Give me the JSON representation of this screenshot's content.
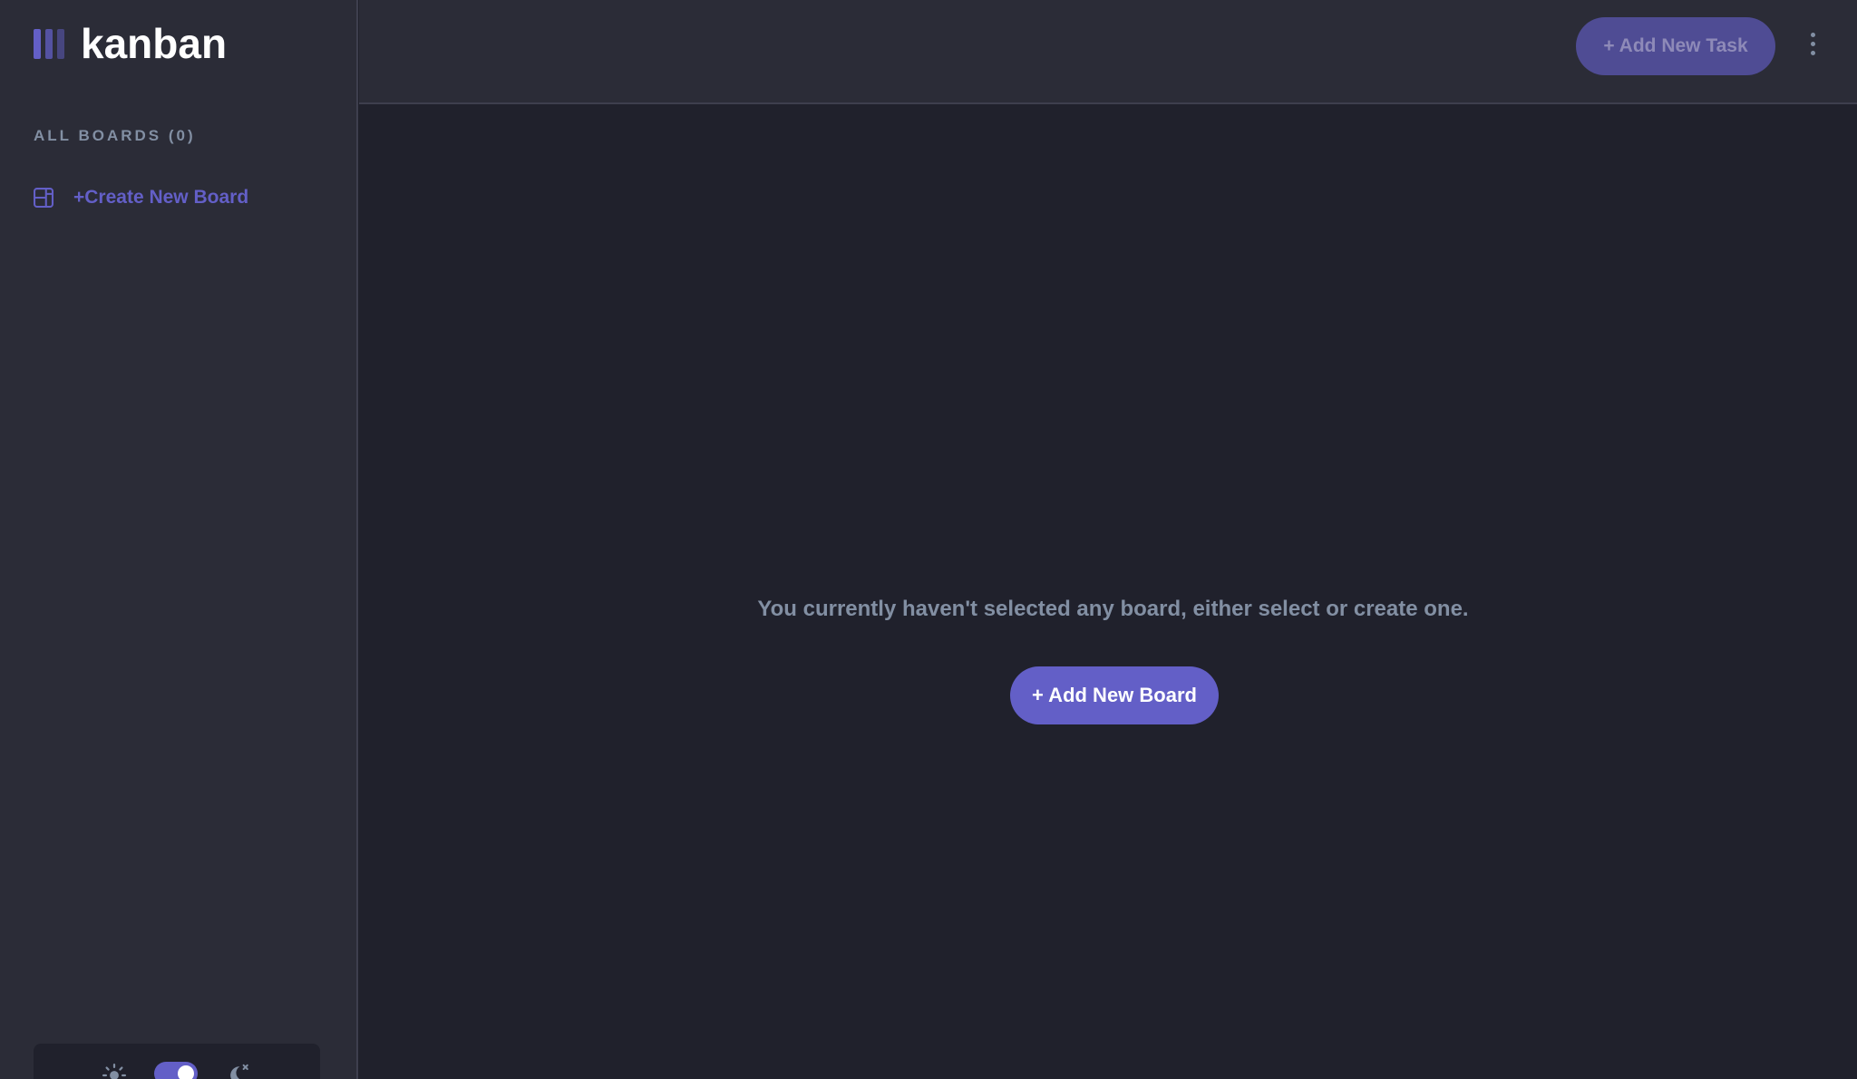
{
  "app": {
    "logo_text": "kanban"
  },
  "sidebar": {
    "boards_heading": "ALL BOARDS (0)",
    "create_board_label": "+Create New Board",
    "board_icon": "board-layout-icon"
  },
  "theme": {
    "light_icon": "sun-icon",
    "dark_icon": "moon-icon",
    "mode": "dark"
  },
  "header": {
    "add_task_label": "+ Add New Task",
    "menu_icon": "vertical-ellipsis-icon"
  },
  "main": {
    "empty_message": "You currently haven't selected any board, either select or create one.",
    "add_board_label": "+ Add New Board"
  },
  "colors": {
    "accent": "#635fc7",
    "sidebar_bg": "#2b2c37",
    "main_bg": "#20212c",
    "muted_text": "#828fa3"
  }
}
